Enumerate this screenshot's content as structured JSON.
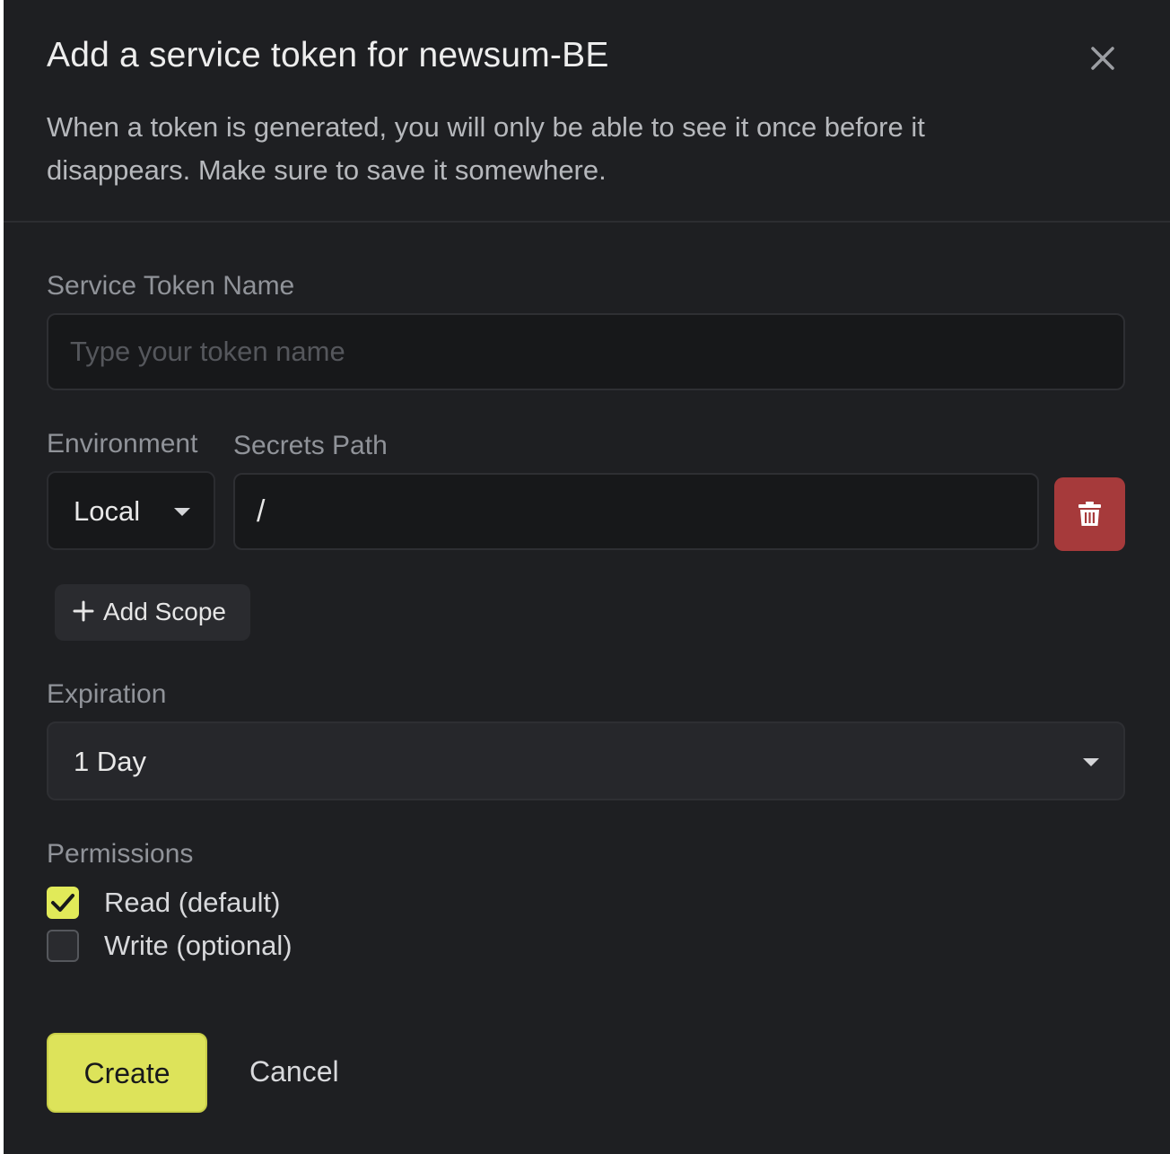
{
  "dialog": {
    "title": "Add a service token for newsum-BE",
    "description": "When a token is generated, you will only be able to see it once before it disappears. Make sure to save it somewhere."
  },
  "token_name": {
    "label": "Service Token Name",
    "value": "",
    "placeholder": "Type your token name"
  },
  "scope": {
    "environment_label": "Environment",
    "environment_value": "Local",
    "secrets_path_label": "Secrets Path",
    "secrets_path_value": "/",
    "delete_icon": "trash-icon",
    "add_scope_label": "Add Scope",
    "add_scope_icon": "plus-icon"
  },
  "expiration": {
    "label": "Expiration",
    "value": "1 Day"
  },
  "permissions": {
    "label": "Permissions",
    "options": [
      {
        "label": "Read (default)",
        "checked": true
      },
      {
        "label": "Write (optional)",
        "checked": false
      }
    ]
  },
  "actions": {
    "create_label": "Create",
    "cancel_label": "Cancel"
  },
  "colors": {
    "background": "#1e1f22",
    "accent": "#dde35a",
    "danger": "#a63a3b"
  }
}
